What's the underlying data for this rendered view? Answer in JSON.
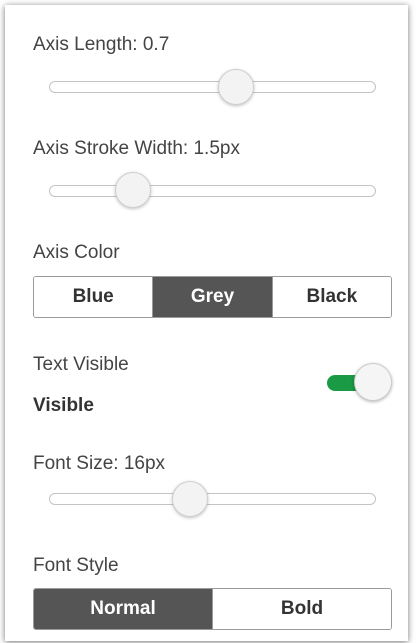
{
  "axis_length": {
    "label": "Axis Length: 0.7",
    "value": 0.7
  },
  "axis_stroke_width": {
    "label": "Axis Stroke Width: 1.5px",
    "value": 1.5
  },
  "axis_color": {
    "label": "Axis Color",
    "options": [
      "Blue",
      "Grey",
      "Black"
    ],
    "selected": "Grey",
    "active_color": "#555555"
  },
  "text_visible": {
    "label": "Text Visible",
    "state_text": "Visible",
    "checked": true,
    "on_color": "#1a9a45"
  },
  "font_size": {
    "label": "Font Size: 16px",
    "value": 16
  },
  "font_style": {
    "label": "Font Style",
    "options": [
      "Normal",
      "Bold"
    ],
    "selected": "Normal"
  }
}
